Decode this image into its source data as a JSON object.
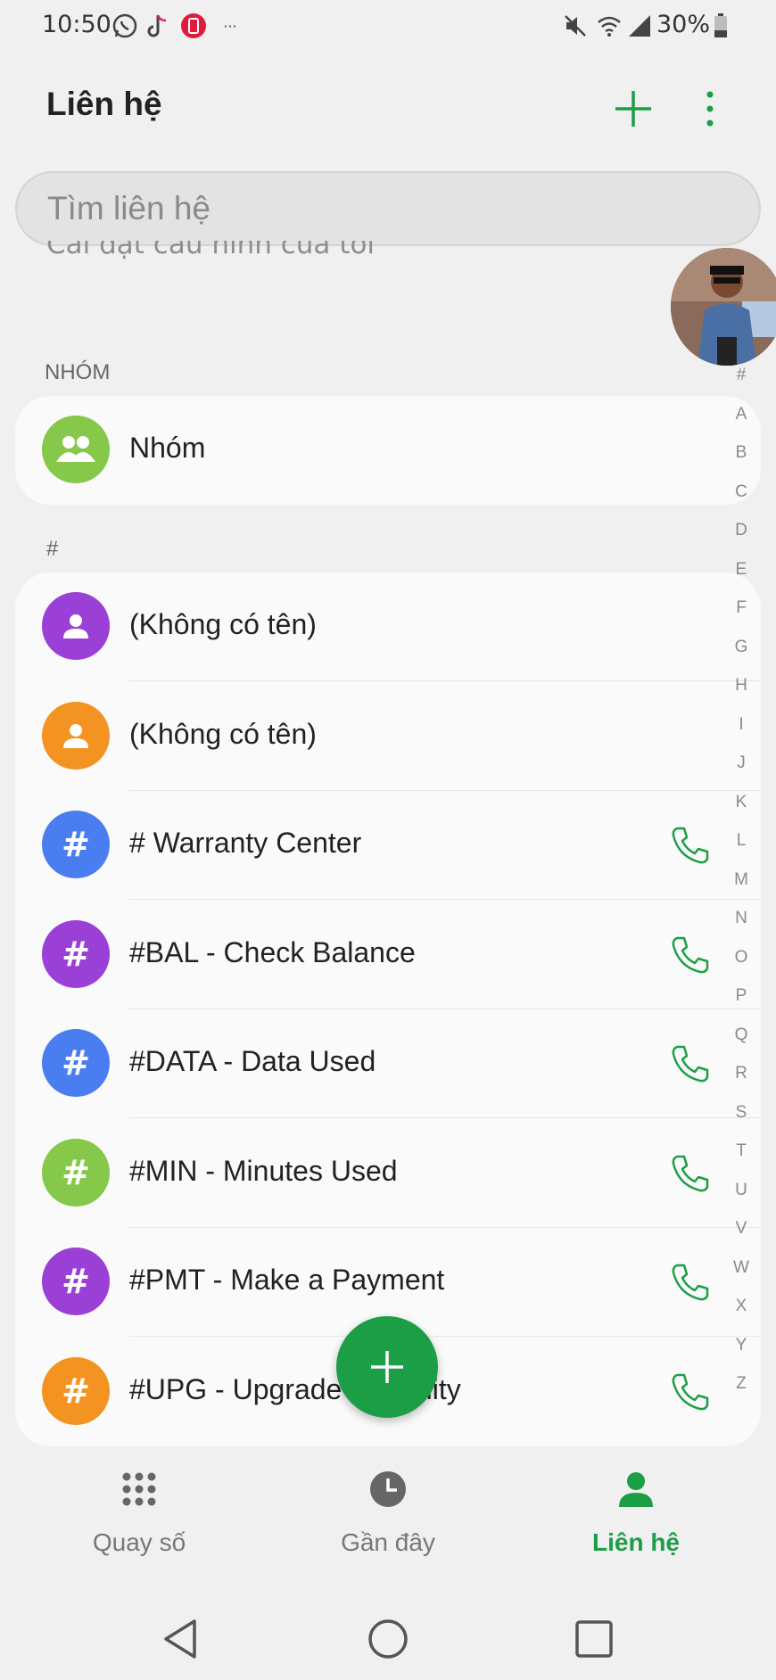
{
  "status_bar": {
    "time": "10:50",
    "battery": "30%"
  },
  "header": {
    "title": "Liên hệ"
  },
  "search": {
    "placeholder": "Tìm liên hệ"
  },
  "faded_text": "Cài đặt cấu hình của tôi",
  "groups_section": {
    "label": "NHÓM",
    "item_label": "Nhóm"
  },
  "hash_section": {
    "label": "#"
  },
  "contacts": [
    {
      "name": "(Không có tên)",
      "avatar": "person-icon",
      "color": "#9b40d6"
    },
    {
      "name": "(Không có tên)",
      "avatar": "person-icon",
      "color": "#f39321"
    },
    {
      "name": "# Warranty Center",
      "avatar": "#",
      "color": "#4a7ef0"
    },
    {
      "name": "#BAL - Check Balance",
      "avatar": "#",
      "color": "#9b40d6"
    },
    {
      "name": "#DATA - Data Used",
      "avatar": "#",
      "color": "#4a7ef0"
    },
    {
      "name": "#MIN - Minutes Used",
      "avatar": "#",
      "color": "#85c84a"
    },
    {
      "name": "#PMT - Make a Payment",
      "avatar": "#",
      "color": "#9b40d6"
    },
    {
      "name": "#UPG - Upgrade Eligibility",
      "avatar": "#",
      "color": "#f39321"
    }
  ],
  "index_letters": [
    "#",
    "A",
    "B",
    "C",
    "D",
    "E",
    "F",
    "G",
    "H",
    "I",
    "J",
    "K",
    "L",
    "M",
    "N",
    "O",
    "P",
    "Q",
    "R",
    "S",
    "T",
    "U",
    "V",
    "W",
    "X",
    "Y",
    "Z"
  ],
  "tabs": [
    {
      "label": "Quay số",
      "icon": "dialpad-icon"
    },
    {
      "label": "Gần đây",
      "icon": "clock-icon"
    },
    {
      "label": "Liên hệ",
      "icon": "contact-person-icon"
    }
  ],
  "colors": {
    "accent": "#1c9e46",
    "background": "#f0f0f0",
    "card": "#fafafa"
  }
}
